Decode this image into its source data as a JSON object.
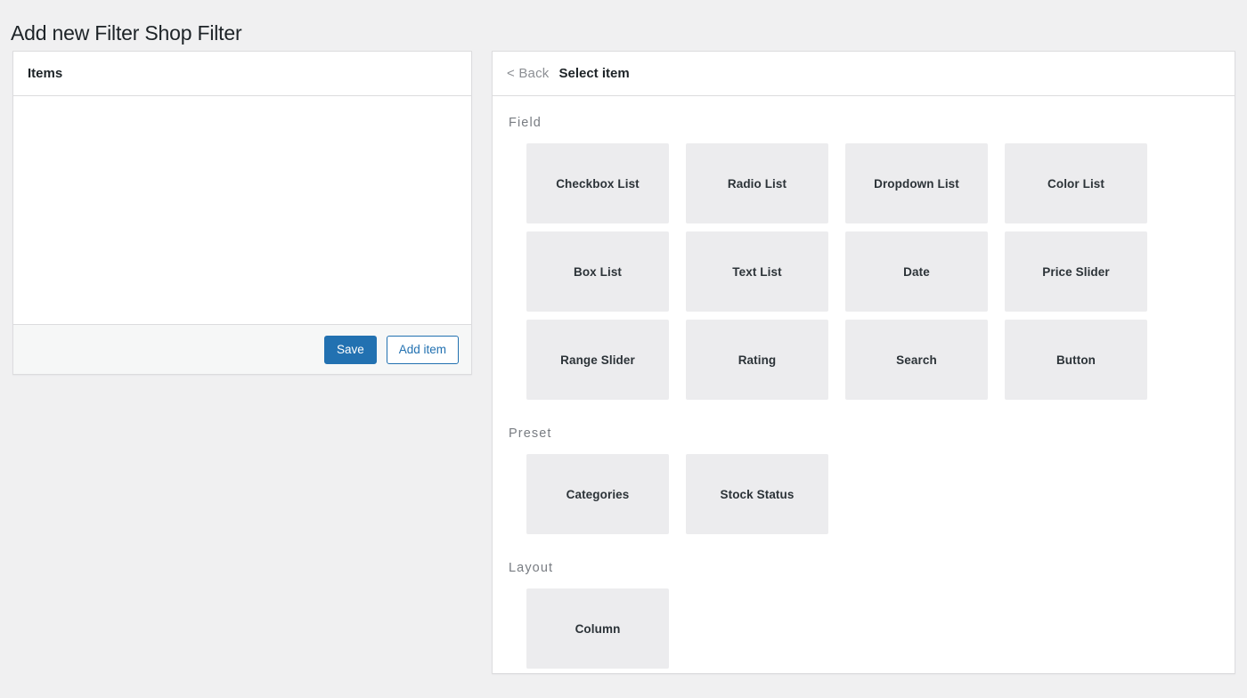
{
  "page": {
    "title": "Add new Filter Shop Filter",
    "background_color": "#f0f0f1"
  },
  "items_panel": {
    "header_title": "Items",
    "body_empty": "",
    "footer": {
      "save_label": "Save",
      "add_item_label": "Add item",
      "primary_color": "#2271b1"
    }
  },
  "select_panel": {
    "back_label": "< Back",
    "header_title": "Select item",
    "groups": [
      {
        "name": "Field",
        "items": [
          {
            "label": "Checkbox List"
          },
          {
            "label": "Radio List"
          },
          {
            "label": "Dropdown List"
          },
          {
            "label": "Color List"
          },
          {
            "label": "Box List"
          },
          {
            "label": "Text List"
          },
          {
            "label": "Date"
          },
          {
            "label": "Price Slider"
          },
          {
            "label": "Range Slider"
          },
          {
            "label": "Rating"
          },
          {
            "label": "Search"
          },
          {
            "label": "Button"
          }
        ]
      },
      {
        "name": "Preset",
        "items": [
          {
            "label": "Categories"
          },
          {
            "label": "Stock Status"
          }
        ]
      },
      {
        "name": "Layout",
        "items": [
          {
            "label": "Column"
          }
        ]
      }
    ]
  }
}
